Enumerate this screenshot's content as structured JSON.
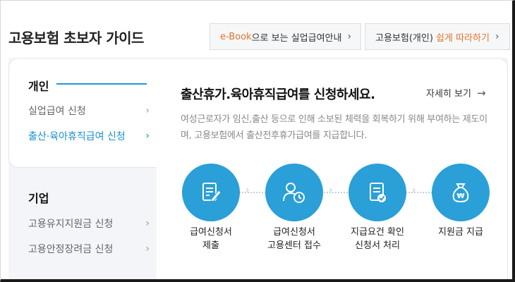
{
  "page_title": "고용보험 초보자 가이드",
  "top_buttons": {
    "ebook": {
      "accent": "e-Book",
      "rest": "으로 보는 실업급여안내"
    },
    "guide": {
      "prefix": "고용보험(개인) ",
      "accent": "쉽게 따라하기"
    }
  },
  "sidebar": {
    "personal": {
      "heading": "개인",
      "items": [
        {
          "label": "실업급여 신청"
        },
        {
          "label": "출산·육아휴직급여 신청",
          "active": true
        }
      ]
    },
    "corporate": {
      "heading": "기업",
      "items": [
        {
          "label": "고용유지지원금 신청"
        },
        {
          "label": "고용안정장려금 신청"
        }
      ]
    }
  },
  "main": {
    "title": "출산휴가.육아휴직급여를 신청하세요.",
    "detail_link": "자세히 보기",
    "description": "여성근로자가 임신,출산 등으로 인해 소보된 체력을 회복하기 위해 부여하는 제도이며, 고용보험에서 출산전후휴가급여를 지급합니다.",
    "steps": [
      {
        "line1": "급여신청서",
        "line2": "제출",
        "icon": "document-pen-icon"
      },
      {
        "line1": "급여신청서",
        "line2": "고용센터 접수",
        "icon": "user-clock-icon"
      },
      {
        "line1": "지급요건 확인",
        "line2": "신청서 처리",
        "icon": "document-check-icon"
      },
      {
        "line1": "지원금 지급",
        "line2": "",
        "icon": "money-bag-icon"
      }
    ]
  },
  "colors": {
    "accent_blue": "#2a9fd8",
    "active_link": "#1a8fd2",
    "accent_orange": "#e8732a",
    "panel_bg": "#f3f5f9"
  }
}
